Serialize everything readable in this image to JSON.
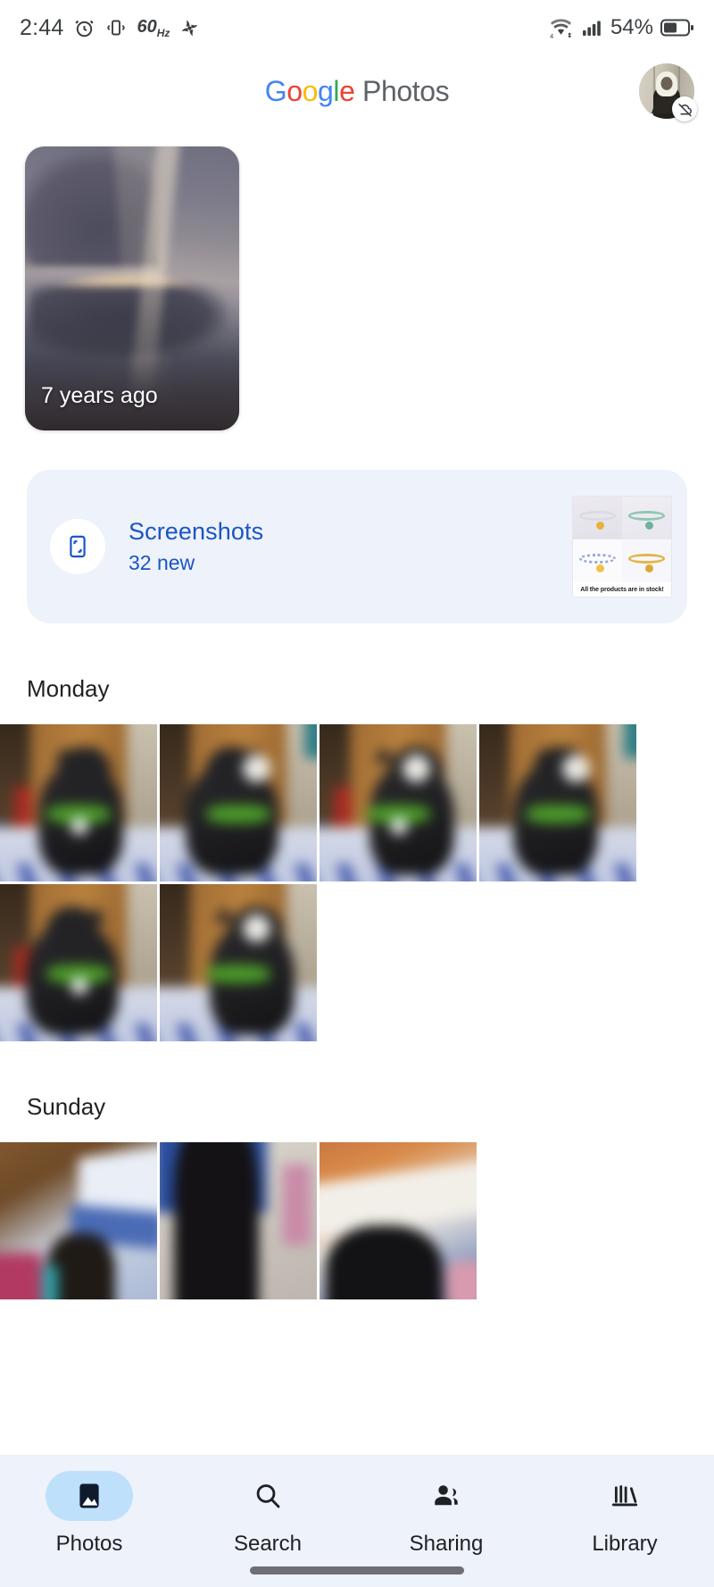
{
  "status_bar": {
    "time": "2:44",
    "alarm_icon": "alarm-clock-icon",
    "vibrate_icon": "vibrate-icon",
    "refresh_rate": "60",
    "refresh_rate_unit": "Hz",
    "fan_icon": "fan-icon",
    "wifi_icon": "wifi-icon",
    "cellular_icon": "cellular-signal-icon",
    "battery_percent": "54%",
    "battery_icon": "battery-icon"
  },
  "header": {
    "logo_letters": [
      "G",
      "o",
      "o",
      "g",
      "l",
      "e"
    ],
    "logo_suffix": "Photos",
    "avatar_name": "account-avatar",
    "avatar_badge": "backup-off-icon"
  },
  "memory": {
    "label": "7 years ago",
    "image_alt": "cloudy sky with sun rays"
  },
  "screenshots_card": {
    "icon": "screenshot-device-icon",
    "title": "Screenshots",
    "subtitle": "32 new",
    "thumbnail_caption": "All the products are in stock!"
  },
  "sections": [
    {
      "day": "Monday",
      "rows": [
        [
          "photo-1",
          "photo-2",
          "photo-3",
          "photo-4"
        ],
        [
          "photo-5",
          "photo-6"
        ]
      ]
    },
    {
      "day": "Sunday",
      "rows": [
        [
          "photo-7",
          "photo-8",
          "photo-9"
        ]
      ]
    }
  ],
  "bottom_nav": {
    "items": [
      {
        "label": "Photos",
        "icon": "photos-icon",
        "active": true
      },
      {
        "label": "Search",
        "icon": "search-icon",
        "active": false
      },
      {
        "label": "Sharing",
        "icon": "sharing-icon",
        "active": false
      },
      {
        "label": "Library",
        "icon": "library-icon",
        "active": false
      }
    ]
  },
  "colors": {
    "google_blue": "#4285F4",
    "google_red": "#EA4335",
    "google_yellow": "#FBBC05",
    "google_green": "#34A853",
    "card_bg": "#eef2fb",
    "link_blue": "#1a56c4",
    "active_pill": "#bfe0fb"
  }
}
